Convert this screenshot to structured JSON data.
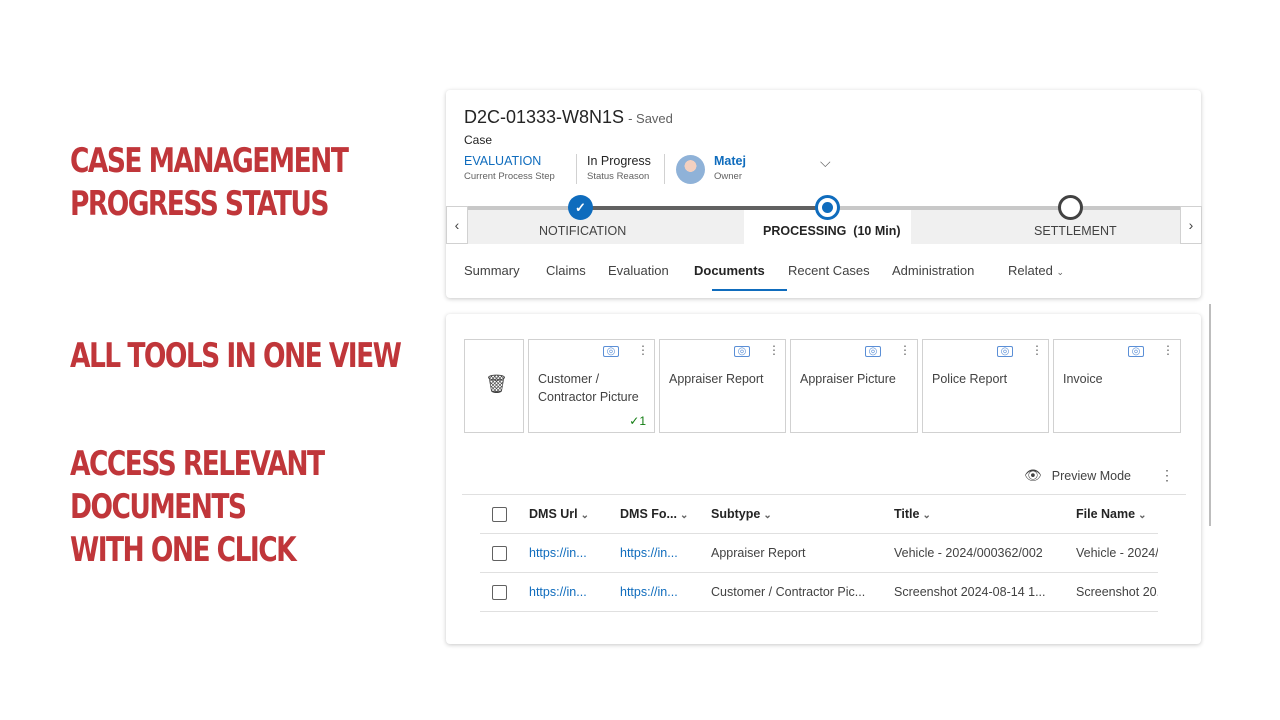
{
  "headlines": {
    "h1": [
      "CASE MANAGEMENT",
      "PROGRESS STATUS"
    ],
    "h2": [
      "ALL TOOLS IN ONE VIEW"
    ],
    "h3": [
      "ACCESS RELEVANT",
      "DOCUMENTS",
      "WITH ONE CLICK"
    ]
  },
  "record": {
    "id": "D2C-01333-W8N1S",
    "saved": "- Saved",
    "entity": "Case",
    "fields": [
      {
        "value": "EVALUATION",
        "label": "Current Process Step"
      },
      {
        "value": "In Progress",
        "label": "Status Reason"
      },
      {
        "value": "Matej",
        "label": "Owner"
      }
    ]
  },
  "process": {
    "stages": [
      "NOTIFICATION",
      "PROCESSING  (10 Min)",
      "SETTLEMENT"
    ],
    "icons": {
      "completed": "check-icon",
      "prev": "chevron-left-icon",
      "next": "chevron-right-icon"
    }
  },
  "tabs": [
    "Summary",
    "Claims",
    "Evaluation",
    "Documents",
    "Recent Cases",
    "Administration",
    "Related"
  ],
  "active_tab": "Documents",
  "documents": {
    "tiles": [
      {
        "name": "Customer / Contractor Picture",
        "count": "✓1"
      },
      {
        "name": "Appraiser Report",
        "count": ""
      },
      {
        "name": "Appraiser Picture",
        "count": ""
      },
      {
        "name": "Police Report",
        "count": ""
      },
      {
        "name": "Invoice",
        "count": ""
      }
    ],
    "preview_label": "Preview Mode",
    "columns": [
      "DMS Url",
      "DMS Fo...",
      "Subtype",
      "Title",
      "File Name"
    ],
    "rows": [
      [
        "https://in...",
        "https://in...",
        "Appraiser Report",
        "Vehicle - 2024/000362/002",
        "Vehicle - 2024/"
      ],
      [
        "https://in...",
        "https://in...",
        "Customer / Contractor Pic...",
        "Screenshot 2024-08-14 1...",
        "Screenshot 20..."
      ]
    ]
  },
  "colors": {
    "accent": "#0f6cbd",
    "headline": "#c0363a"
  }
}
